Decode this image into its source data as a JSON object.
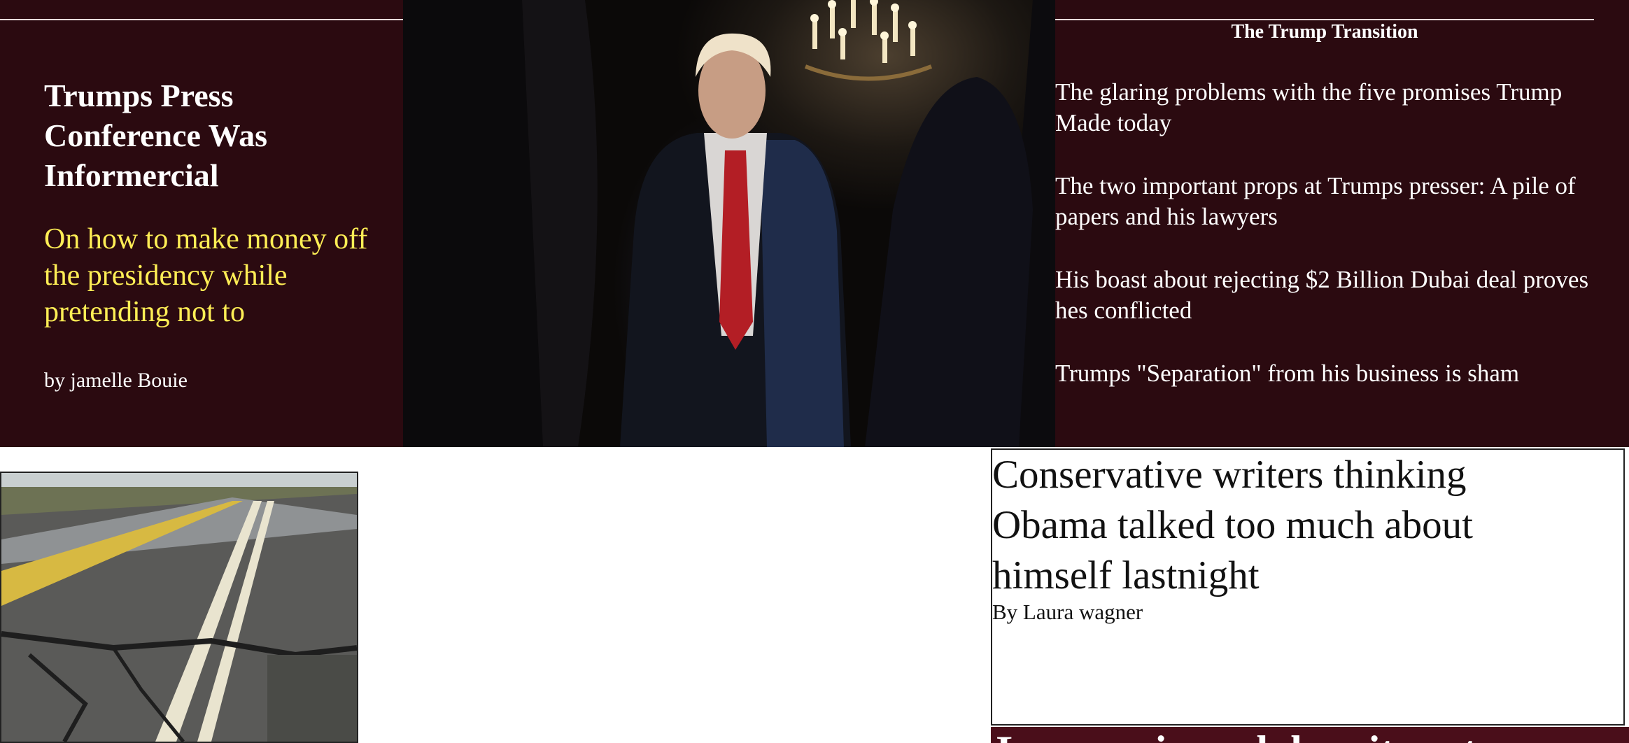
{
  "lead_story": {
    "title": "Trumps Press Conference Was Informercial",
    "dek": "On how to make money off the presidency while pretending not to",
    "byline": "by jamelle Bouie"
  },
  "sidebar": {
    "section_title": "The Trump Transition",
    "stories": [
      "The glaring problems with the five promises Trump Made today",
      "The two important props at Trumps presser: A pile of papers and his lawyers",
      "His boast about rejecting $2 Billion Dubai deal proves hes conflicted",
      "Trumps \"Separation\" from his business is sham"
    ]
  },
  "feature_card": {
    "title": "Conservative writers thinking Obama talked too much about himself lastnight",
    "byline": "By Laura wagner"
  },
  "next_strip": {
    "text": "Lame m inc ecl does it eact"
  },
  "colors": {
    "hero_bg": "#2b0a10",
    "dek": "#ffee55",
    "strip_bg": "#4a0e1a"
  }
}
